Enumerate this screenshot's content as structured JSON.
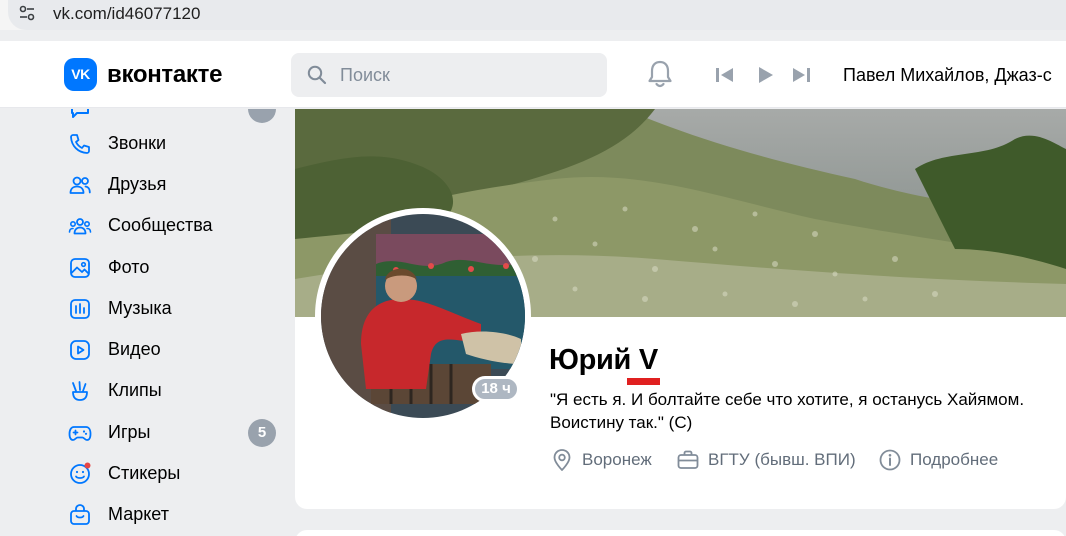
{
  "browser": {
    "url": "vk.com/id46077120",
    "settings_icon": "site-settings-icon"
  },
  "header": {
    "logo_mark": "VK",
    "logo_text": "вконтакте",
    "search_placeholder": "Поиск",
    "now_playing": "Павел Михайлов, Джаз-с",
    "icons": [
      "search-icon",
      "bell-icon",
      "previous-track-icon",
      "play-icon",
      "next-track-icon"
    ]
  },
  "sidebar": {
    "items": [
      {
        "label": "Звонки",
        "icon": "phone-icon"
      },
      {
        "label": "Друзья",
        "icon": "friends-icon"
      },
      {
        "label": "Сообщества",
        "icon": "communities-icon"
      },
      {
        "label": "Фото",
        "icon": "photo-icon"
      },
      {
        "label": "Музыка",
        "icon": "music-icon"
      },
      {
        "label": "Видео",
        "icon": "video-icon"
      },
      {
        "label": "Клипы",
        "icon": "clips-icon"
      },
      {
        "label": "Игры",
        "icon": "games-icon",
        "badge": "5"
      },
      {
        "label": "Стикеры",
        "icon": "stickers-icon"
      },
      {
        "label": "Маркет",
        "icon": "market-icon"
      }
    ]
  },
  "profile": {
    "name_first": "Юрий",
    "name_last": "V",
    "last_seen": "18 ч",
    "status": "\"Я есть я. И болтайте себе что хотите, я останусь Хайямом. Воистину так.\" (С)",
    "city": "Воронеж",
    "education": "ВГТУ (бывш. ВПИ)",
    "more": "Подробнее"
  },
  "colors": {
    "accent": "#0077ff",
    "badge": "#99a2ad",
    "secondary_text": "#626d7a",
    "highlight": "#e02020"
  }
}
